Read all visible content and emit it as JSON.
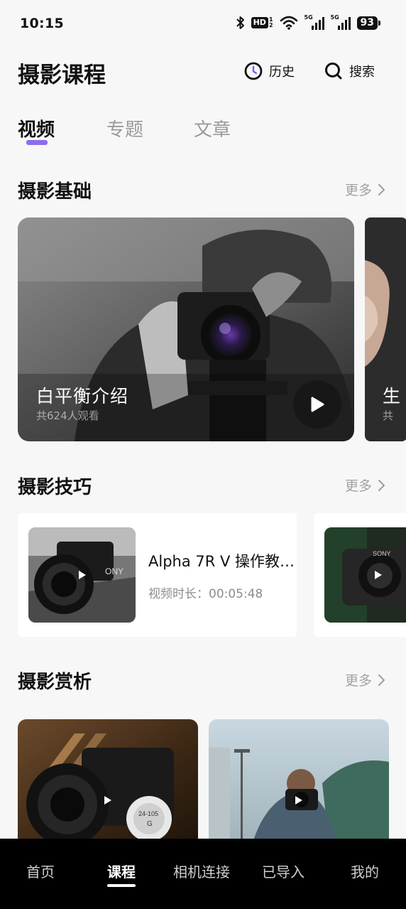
{
  "status_bar": {
    "time": "10:15",
    "hd_label": "HD",
    "hd_sub_top": "1",
    "hd_sub_bottom": "2",
    "sim1_label": "5G",
    "sim2_label": "5G",
    "battery": "93"
  },
  "header": {
    "title": "摄影课程",
    "history_label": "历史",
    "search_label": "搜索"
  },
  "tabs": [
    {
      "label": "视频",
      "active": true
    },
    {
      "label": "专题",
      "active": false
    },
    {
      "label": "文章",
      "active": false
    }
  ],
  "sections": {
    "basics": {
      "title": "摄影基础",
      "more_label": "更多",
      "cards": [
        {
          "title": "白平衡介绍",
          "subtitle": "共624人观看"
        },
        {
          "title": "生",
          "subtitle": "共"
        }
      ]
    },
    "tips": {
      "title": "摄影技巧",
      "more_label": "更多",
      "cards": [
        {
          "title": "Alpha 7R V 操作教…",
          "duration_label": "视频时长：",
          "duration": "00:05:48"
        }
      ]
    },
    "appreciation": {
      "title": "摄影赏析",
      "more_label": "更多"
    }
  },
  "bottom_nav": [
    {
      "label": "首页",
      "active": false
    },
    {
      "label": "课程",
      "active": true
    },
    {
      "label": "相机连接",
      "active": false
    },
    {
      "label": "已导入",
      "active": false
    },
    {
      "label": "我的",
      "active": false
    }
  ],
  "colors": {
    "accent": "#8b6cf0",
    "background": "#f7f7f7",
    "nav_background": "#000000"
  }
}
